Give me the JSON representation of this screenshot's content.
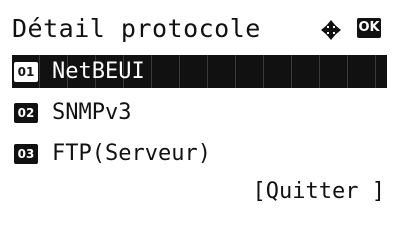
{
  "header": {
    "title": "Détail protocole",
    "nav_icon": "up-down-arrows-icon",
    "ok_label": "OK"
  },
  "menu": {
    "items": [
      {
        "number": "01",
        "label": "NetBEUI",
        "selected": true
      },
      {
        "number": "02",
        "label": "SNMPv3",
        "selected": false
      },
      {
        "number": "03",
        "label": "FTP(Serveur)",
        "selected": false
      }
    ]
  },
  "footer": {
    "quit_label": "[Quitter ]"
  },
  "colors": {
    "background": "#ffffff",
    "foreground": "#111111",
    "highlight": "#111111"
  }
}
